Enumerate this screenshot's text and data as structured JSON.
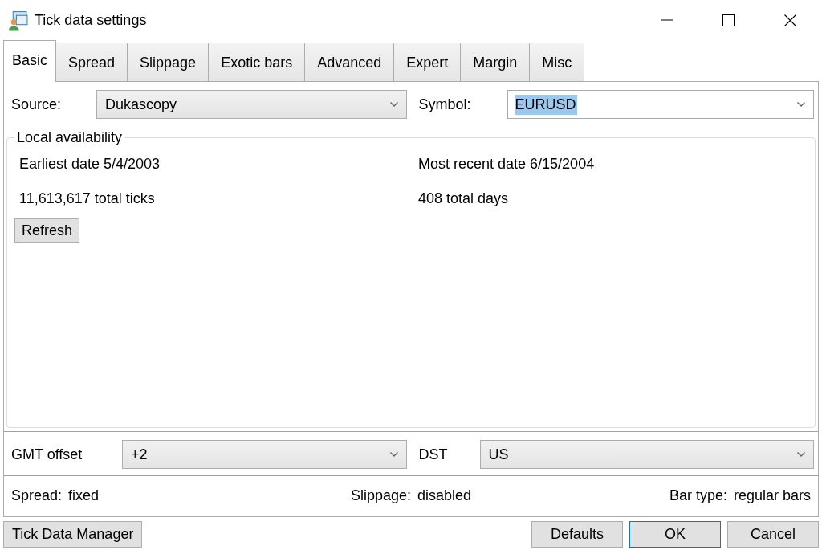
{
  "window": {
    "title": "Tick data settings"
  },
  "tabs": [
    {
      "label": "Basic",
      "selected": true
    },
    {
      "label": "Spread",
      "selected": false
    },
    {
      "label": "Slippage",
      "selected": false
    },
    {
      "label": "Exotic bars",
      "selected": false
    },
    {
      "label": "Advanced",
      "selected": false
    },
    {
      "label": "Expert",
      "selected": false
    },
    {
      "label": "Margin",
      "selected": false
    },
    {
      "label": "Misc",
      "selected": false
    }
  ],
  "source_row": [
    {
      "label": "Source:",
      "value": "Dukascopy",
      "kind": "dropdown",
      "text_selected": false
    },
    {
      "label": "Symbol:",
      "value": "EURUSD",
      "kind": "editable",
      "text_selected": true
    }
  ],
  "local_availability": {
    "title": "Local availability",
    "stats": [
      "Earliest date 5/4/2003",
      "Most recent date 6/15/2004",
      "11,613,617 total ticks",
      "408 total days"
    ],
    "refresh_button": "Refresh"
  },
  "time_row": [
    {
      "label": "GMT offset",
      "value": "+2",
      "kind": "dropdown",
      "text_selected": false
    },
    {
      "label": "DST",
      "value": "US",
      "kind": "dropdown",
      "text_selected": false
    }
  ],
  "summary": [
    {
      "label": "Spread:",
      "value": "fixed"
    },
    {
      "label": "Slippage:",
      "value": "disabled"
    },
    {
      "label": "Bar type:",
      "value": "regular bars"
    }
  ],
  "manager_button": "Tick Data Manager",
  "buttons": [
    {
      "label": "Defaults",
      "default": false
    },
    {
      "label": "OK",
      "default": true
    },
    {
      "label": "Cancel",
      "default": false
    }
  ]
}
